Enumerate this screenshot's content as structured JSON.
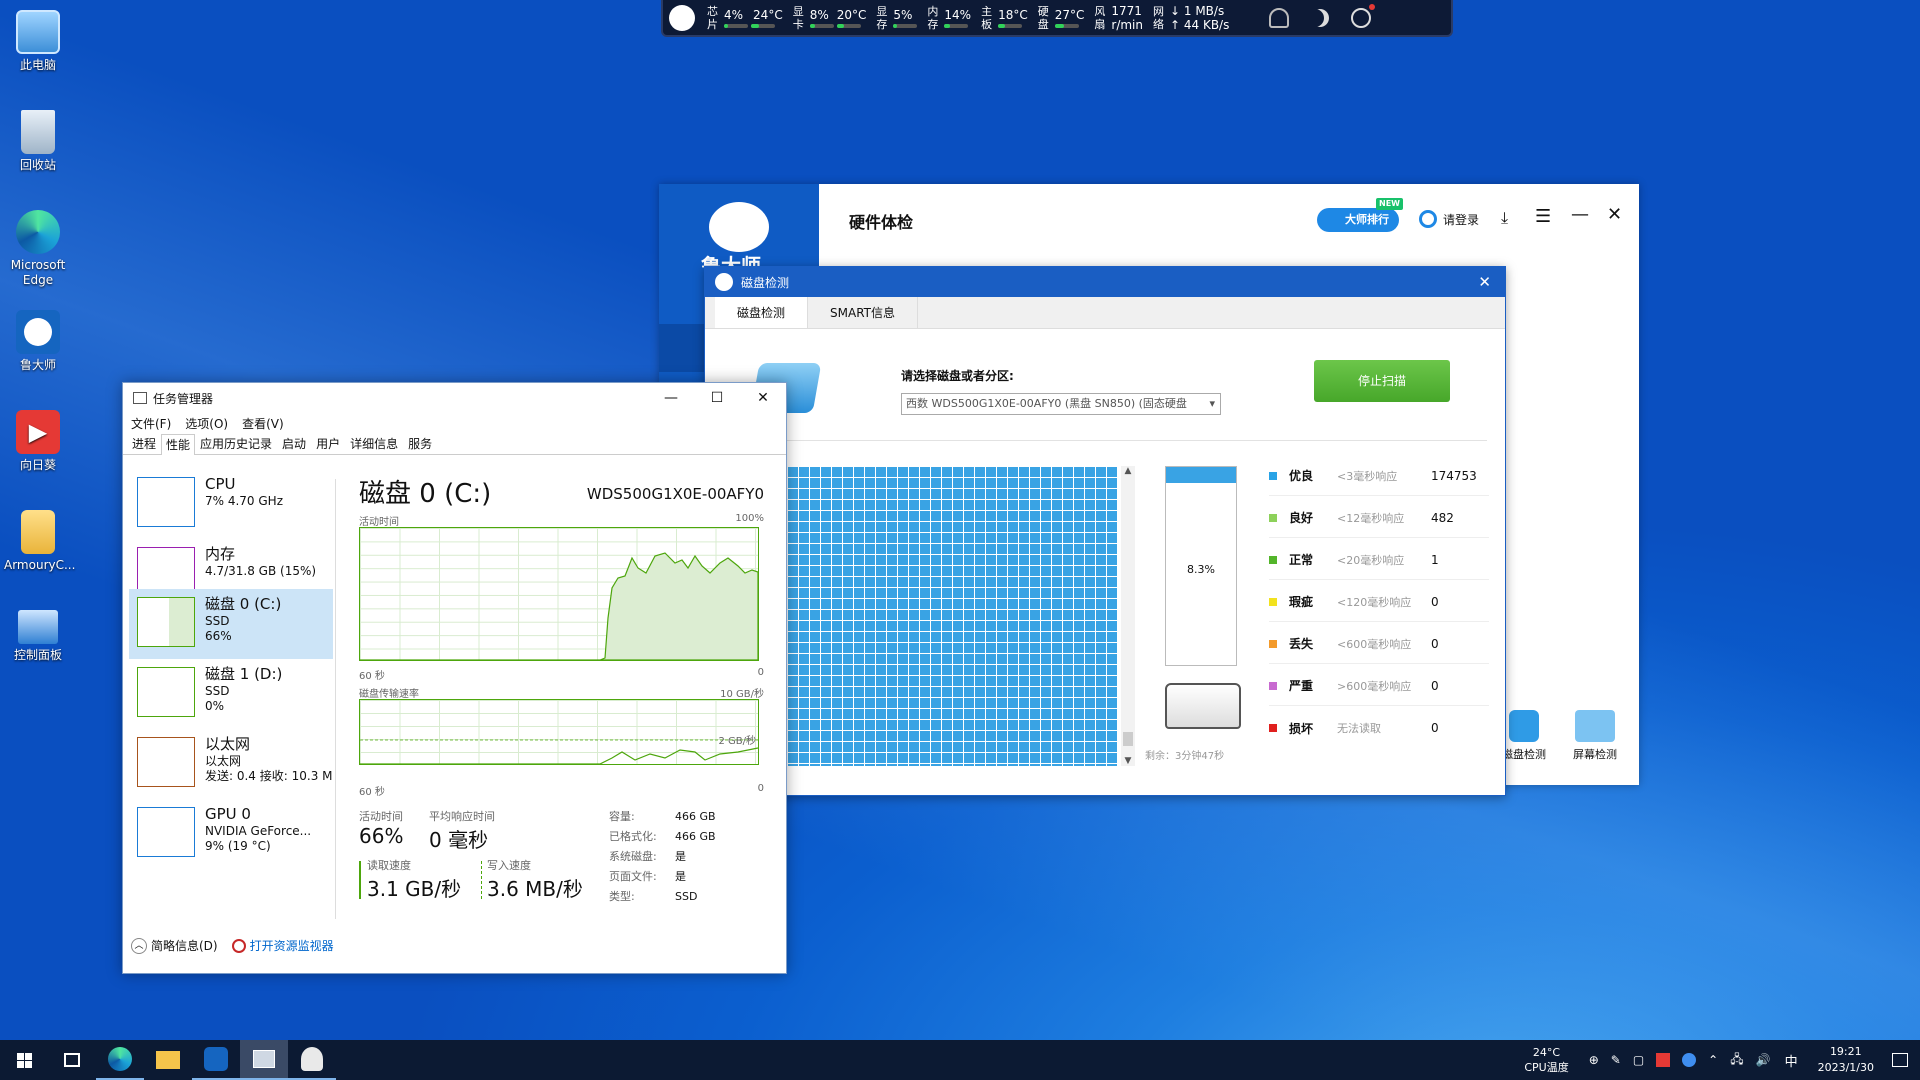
{
  "desktop": {
    "icons": [
      {
        "label": "此电脑",
        "color": "#7cc3ff"
      },
      {
        "label": "回收站",
        "color": "#c9d8e8"
      },
      {
        "label": "Microsoft Edge",
        "color": "#1ba2d7"
      },
      {
        "label": "鲁大师",
        "color": "#1565c0"
      },
      {
        "label": "向日葵",
        "color": "#e53935"
      },
      {
        "label": "ArmouryC...",
        "color": "#f6c54b"
      },
      {
        "label": "控制面板",
        "color": "#2f7fd3"
      }
    ]
  },
  "hwmonitor": {
    "items": [
      {
        "label1": "芯",
        "label2": "片",
        "v1": "4%",
        "v2": "24°C"
      },
      {
        "label1": "显",
        "label2": "卡",
        "v1": "8%",
        "v2": "20°C"
      },
      {
        "label1": "显",
        "label2": "存",
        "v1": "5%",
        "v2": ""
      },
      {
        "label1": "内",
        "label2": "存",
        "v1": "14%",
        "v2": ""
      },
      {
        "label1": "主",
        "label2": "板",
        "v1": "18°C",
        "v2": ""
      },
      {
        "label1": "硬",
        "label2": "盘",
        "v1": "27°C",
        "v2": ""
      },
      {
        "label1": "风",
        "label2": "扇",
        "v1": "1771",
        "v2": "r/min"
      },
      {
        "label1": "网",
        "label2": "络",
        "v1": "↓ 1 MB/s",
        "v2": "↑ 44 KB/s"
      }
    ]
  },
  "ludashi": {
    "title": "硬件体检",
    "brand": "鲁大师",
    "rank_badge": "大师排行",
    "new_badge": "NEW",
    "login": "请登录",
    "bottom_tools": [
      "磁盘检测",
      "屏幕检测"
    ]
  },
  "disk_dialog": {
    "title": "磁盘检测",
    "tabs": [
      "磁盘检测",
      "SMART信息"
    ],
    "select_label": "请选择磁盘或者分区:",
    "select_value": "西数 WDS500G1X0E-00AFY0 (黑盘 SN850) (固态硬盘",
    "stop_button": "停止扫描",
    "progress": "8.3%",
    "progress_value": 0.083,
    "remaining": "剩余：3分钟47秒",
    "legend": [
      {
        "name": "优良",
        "desc": "<3毫秒响应",
        "count": "174753",
        "color": "#29a3e6"
      },
      {
        "name": "良好",
        "desc": "<12毫秒响应",
        "count": "482",
        "color": "#8dd15a"
      },
      {
        "name": "正常",
        "desc": "<20毫秒响应",
        "count": "1",
        "color": "#53b52a"
      },
      {
        "name": "瑕疵",
        "desc": "<120毫秒响应",
        "count": "0",
        "color": "#f2e21e"
      },
      {
        "name": "丢失",
        "desc": "<600毫秒响应",
        "count": "0",
        "color": "#f39a2b"
      },
      {
        "name": "严重",
        "desc": ">600毫秒响应",
        "count": "0",
        "color": "#c86ad0"
      },
      {
        "name": "损坏",
        "desc": "无法读取",
        "count": "0",
        "color": "#e0201e"
      }
    ]
  },
  "taskmgr": {
    "title": "任务管理器",
    "menu": [
      "文件(F)",
      "选项(O)",
      "查看(V)"
    ],
    "tabs": [
      "进程",
      "性能",
      "应用历史记录",
      "启动",
      "用户",
      "详细信息",
      "服务"
    ],
    "sidebar": [
      {
        "name": "CPU",
        "l2": "7% 4.70 GHz",
        "l3": "",
        "color": "#1a7bd6"
      },
      {
        "name": "内存",
        "l2": "4.7/31.8 GB (15%)",
        "l3": "",
        "color": "#9a1fb0"
      },
      {
        "name": "磁盘 0 (C:)",
        "l2": "SSD",
        "l3": "66%",
        "color": "#4da60c"
      },
      {
        "name": "磁盘 1 (D:)",
        "l2": "SSD",
        "l3": "0%",
        "color": "#4da60c"
      },
      {
        "name": "以太网",
        "l2": "以太网",
        "l3": "发送: 0.4 接收: 10.3 M",
        "color": "#a7541d"
      },
      {
        "name": "GPU 0",
        "l2": "NVIDIA GeForce...",
        "l3": "9% (19 °C)",
        "color": "#1a7bd6"
      }
    ],
    "main": {
      "title": "磁盘 0 (C:)",
      "model": "WDS500G1X0E-00AFY0",
      "g1_label": "活动时间",
      "g1_max": "100%",
      "g1_time": "60 秒",
      "g1_min": "0",
      "g2_label": "磁盘传输速率",
      "g2_max": "10 GB/秒",
      "g2_mark": "2 GB/秒",
      "g2_time": "60 秒",
      "g2_min": "0",
      "active_label": "活动时间",
      "active_value": "66%",
      "resp_label": "平均响应时间",
      "resp_value": "0 毫秒",
      "read_label": "读取速度",
      "read_value": "3.1 GB/秒",
      "write_label": "写入速度",
      "write_value": "3.6 MB/秒",
      "props": [
        {
          "k": "容量:",
          "v": "466 GB"
        },
        {
          "k": "已格式化:",
          "v": "466 GB"
        },
        {
          "k": "系统磁盘:",
          "v": "是"
        },
        {
          "k": "页面文件:",
          "v": "是"
        },
        {
          "k": "类型:",
          "v": "SSD"
        }
      ]
    },
    "footer": {
      "brief": "简略信息(D)",
      "monitor": "打开资源监视器"
    }
  },
  "taskbar": {
    "cpu_temp": "24°C",
    "cpu_temp_label": "CPU温度",
    "ime": "中",
    "time": "19:21",
    "date": "2023/1/30"
  }
}
